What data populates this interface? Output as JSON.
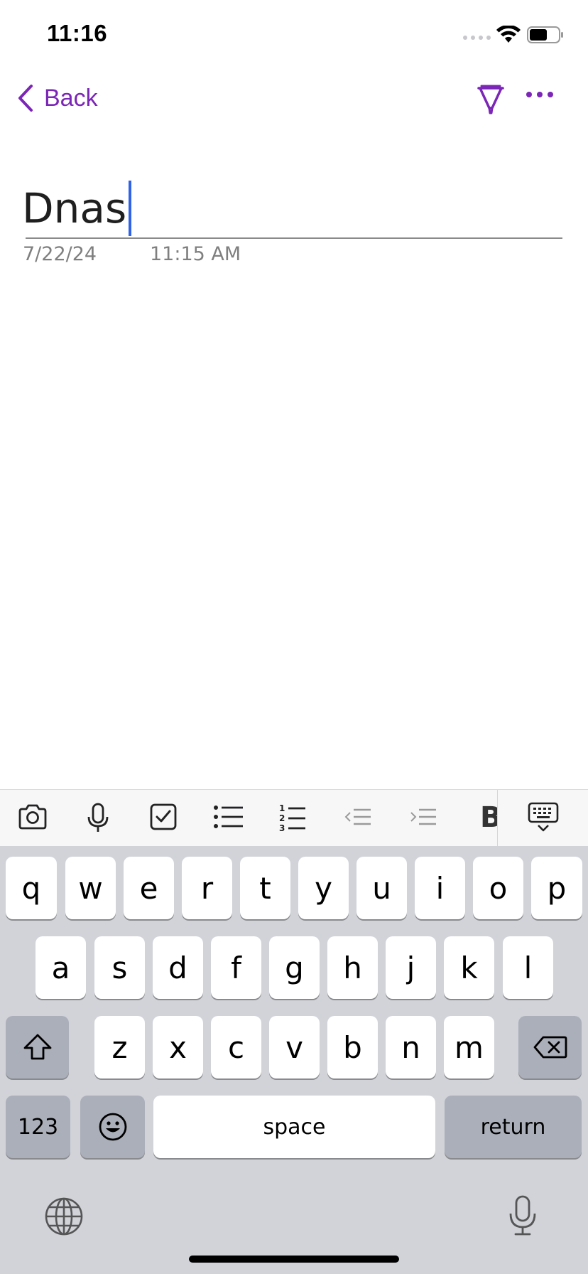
{
  "status_bar": {
    "time": "11:16"
  },
  "nav": {
    "back_label": "Back"
  },
  "note": {
    "title": "Dnas",
    "date": "7/22/24",
    "time": "11:15 AM"
  },
  "toolbar": {
    "bold_label": "B"
  },
  "keyboard": {
    "row1": [
      "q",
      "w",
      "e",
      "r",
      "t",
      "y",
      "u",
      "i",
      "o",
      "p"
    ],
    "row2": [
      "a",
      "s",
      "d",
      "f",
      "g",
      "h",
      "j",
      "k",
      "l"
    ],
    "row3": [
      "z",
      "x",
      "c",
      "v",
      "b",
      "n",
      "m"
    ],
    "numbers_label": "123",
    "space_label": "space",
    "return_label": "return"
  },
  "colors": {
    "accent": "#7b26b6",
    "caret": "#2f62e6",
    "keyboard_bg": "#d1d3d9"
  }
}
